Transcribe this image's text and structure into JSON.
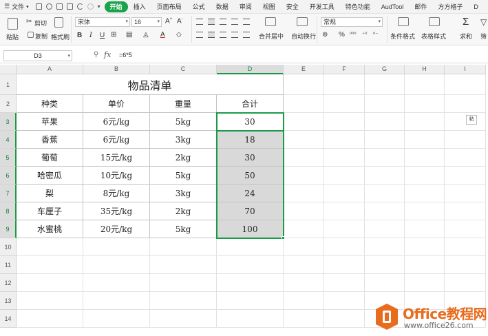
{
  "menu": {
    "file_label": "文件",
    "tabs": [
      "开始",
      "插入",
      "页面布局",
      "公式",
      "数据",
      "审阅",
      "视图",
      "安全",
      "开发工具",
      "特色功能",
      "AudTool",
      "邮件",
      "方方格子",
      "D"
    ],
    "active_tab_index": 0
  },
  "ribbon": {
    "paste_label": "粘贴",
    "cut_label": "剪切",
    "copy_label": "复制",
    "format_painter_label": "格式刷",
    "font_name": "宋体",
    "font_size": "16",
    "merge_label": "合并居中",
    "wrap_label": "自动换行",
    "number_format": "常规",
    "conditional_label": "条件格式",
    "table_style_label": "表格样式",
    "sum_label": "求和",
    "filter_label": "筛"
  },
  "formula_bar": {
    "cell_ref": "D3",
    "fx": "fx",
    "formula": "=6*5"
  },
  "sheet": {
    "columns": [
      "A",
      "B",
      "C",
      "D",
      "E",
      "F",
      "G",
      "H",
      "I"
    ],
    "rows": [
      "1",
      "2",
      "3",
      "4",
      "5",
      "6",
      "7",
      "8",
      "9",
      "10",
      "11",
      "12",
      "13",
      "14"
    ],
    "title": "物品清单",
    "headers": [
      "种类",
      "单价",
      "重量",
      "合计"
    ],
    "data": [
      [
        "苹果",
        "6元/kg",
        "5kg",
        "30"
      ],
      [
        "香蕉",
        "6元/kg",
        "3kg",
        "18"
      ],
      [
        "葡萄",
        "15元/kg",
        "2kg",
        "30"
      ],
      [
        "哈密瓜",
        "10元/kg",
        "5kg",
        "50"
      ],
      [
        "梨",
        "8元/kg",
        "3kg",
        "24"
      ],
      [
        "车厘子",
        "35元/kg",
        "2kg",
        "70"
      ],
      [
        "水蜜桃",
        "20元/kg",
        "5kg",
        "100"
      ]
    ],
    "paste_tag": "粘"
  },
  "watermark": {
    "title": "Office教程网",
    "url": "www.office26.com",
    "accent_color": "#e86c1e"
  }
}
